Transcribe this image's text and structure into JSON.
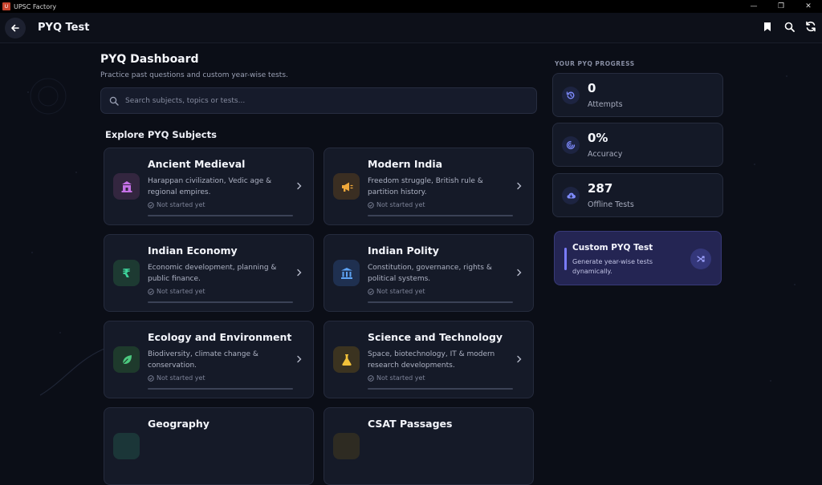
{
  "window": {
    "app_title": "UPSC Factory",
    "controls": [
      "minimize",
      "maximize",
      "close"
    ]
  },
  "appbar": {
    "title": "PYQ Test",
    "icons": [
      "back-arrow-icon",
      "bookmark-icon",
      "search-icon",
      "refresh-icon"
    ]
  },
  "dashboard": {
    "title": "PYQ Dashboard",
    "subtitle": "Practice past questions and custom year-wise tests.",
    "search_placeholder": "Search subjects, topics or tests..."
  },
  "explore": {
    "heading": "Explore PYQ Subjects",
    "subjects": [
      {
        "title": "Ancient Medieval",
        "desc": "Harappan civilization, Vedic age & regional empires.",
        "status": "Not started yet",
        "icon": "temple-icon",
        "progress": 0
      },
      {
        "title": "Modern India",
        "desc": "Freedom struggle, British rule & partition history.",
        "status": "Not started yet",
        "icon": "megaphone-icon",
        "progress": 0
      },
      {
        "title": "Indian Economy",
        "desc": "Economic development, planning & public finance.",
        "status": "Not started yet",
        "icon": "rupee-icon",
        "progress": 0
      },
      {
        "title": "Indian Polity",
        "desc": "Constitution, governance, rights & political systems.",
        "status": "Not started yet",
        "icon": "parliament-icon",
        "progress": 0
      },
      {
        "title": "Ecology and Environment",
        "desc": "Biodiversity, climate change & conservation.",
        "status": "Not started yet",
        "icon": "leaf-icon",
        "progress": 0
      },
      {
        "title": "Science and Technology",
        "desc": "Space, biotechnology, IT & modern research developments.",
        "status": "Not started yet",
        "icon": "flask-icon",
        "progress": 0
      },
      {
        "title": "Geography",
        "desc": "",
        "status": "",
        "icon": "globe-icon",
        "progress": 0
      },
      {
        "title": "CSAT Passages",
        "desc": "",
        "status": "",
        "icon": "book-icon",
        "progress": 0
      }
    ]
  },
  "progress": {
    "label": "YOUR PYQ PROGRESS",
    "stats": [
      {
        "value": "0",
        "label": "Attempts",
        "icon": "history-icon"
      },
      {
        "value": "0%",
        "label": "Accuracy",
        "icon": "target-icon"
      },
      {
        "value": "287",
        "label": "Offline Tests",
        "icon": "cloud-download-icon"
      }
    ]
  },
  "custom_test": {
    "title": "Custom PYQ Test",
    "desc": "Generate year-wise tests dynamically.",
    "icon": "shuffle-icon"
  },
  "colors": {
    "background": "#0b0e17",
    "card": "#151a28",
    "accent": "#6b74ff",
    "custom_card": "#242553"
  }
}
